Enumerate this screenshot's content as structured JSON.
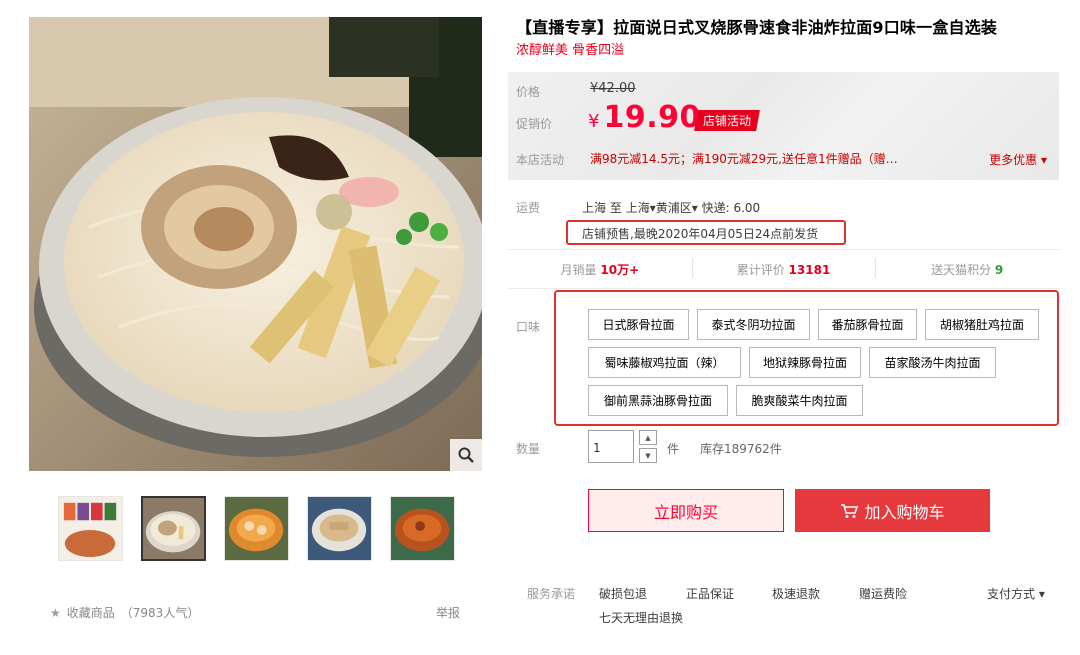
{
  "product": {
    "title": "【直播专享】拉面说日式叉烧豚骨速食非油炸拉面9口味一盒自选装",
    "subtitle": "浓醇鲜美 骨香四溢"
  },
  "price": {
    "price_label": "价格",
    "original": "¥42.00",
    "promo_label": "促销价",
    "currency": "¥",
    "promo_value": "19.90",
    "promo_tag": "店铺活动",
    "activity_label": "本店活动",
    "activity_text": "满98元减14.5元；满190元减29元,送任意1件赠品（赠…",
    "more_offers": "更多优惠"
  },
  "shipping": {
    "label": "运费",
    "from": "上海",
    "to_word": "至",
    "destination": "上海",
    "district": "黄浦区",
    "express": "快递: 6.00",
    "presale": "店铺预售,最晚2020年04月05日24点前发货"
  },
  "stats": {
    "monthly_label": "月销量",
    "monthly_value": "10万+",
    "reviews_label": "累计评价",
    "reviews_value": "13181",
    "points_label": "送天猫积分",
    "points_value": "9"
  },
  "flavor": {
    "label": "口味",
    "options": [
      "日式豚骨拉面",
      "泰式冬阴功拉面",
      "番茄豚骨拉面",
      "胡椒猪肚鸡拉面",
      "蜀味藤椒鸡拉面（辣）",
      "地狱辣豚骨拉面",
      "苗家酸汤牛肉拉面",
      "御前黑蒜油豚骨拉面",
      "脆爽酸菜牛肉拉面"
    ]
  },
  "quantity": {
    "label": "数量",
    "value": "1",
    "unit": "件",
    "stock": "库存189762件"
  },
  "actions": {
    "buy_now": "立即购买",
    "add_cart": "加入购物车"
  },
  "service": {
    "label": "服务承诺",
    "items": [
      "破损包退",
      "正品保证",
      "极速退款",
      "赠运费险",
      "七天无理由退换"
    ],
    "pay_method": "支付方式"
  },
  "favorite": {
    "label": "收藏商品",
    "popularity": "（7983人气）"
  },
  "report": "举报",
  "colors": {
    "accent_red": "#ff0036",
    "cart_red": "#e5393d",
    "highlight_box": "#e0302a",
    "points_green": "#22a335"
  }
}
